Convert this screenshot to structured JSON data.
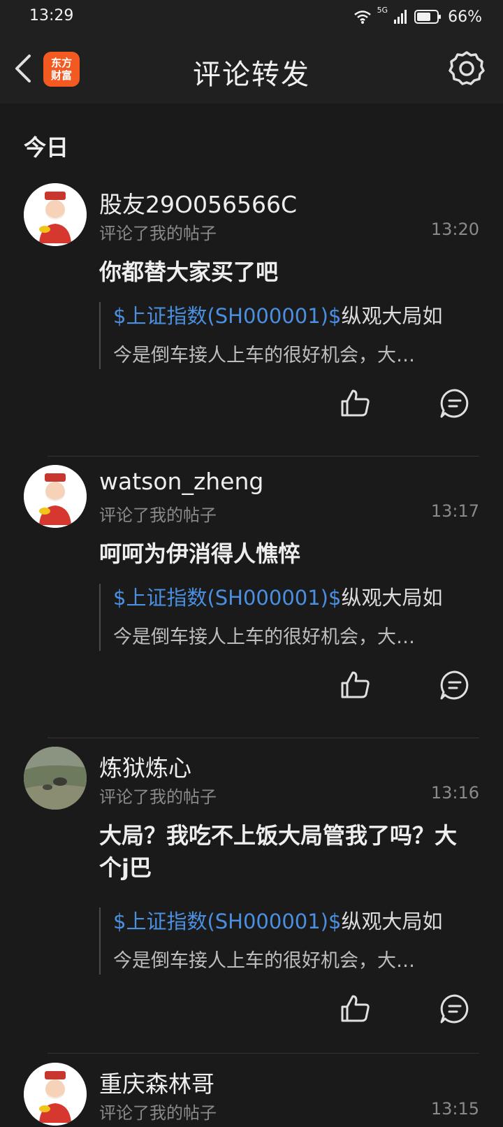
{
  "status_bar": {
    "time": "13:29",
    "network": "5G",
    "battery": "66%"
  },
  "header": {
    "logo_line1": "东方",
    "logo_line2": "财富",
    "title": "评论转发",
    "icons": {
      "back": "chevron-left-icon",
      "settings": "gear-icon"
    }
  },
  "section": {
    "title": "今日"
  },
  "colors": {
    "background": "#1a1a1a",
    "header_background": "#202020",
    "link": "#4a8fe0",
    "logo": "#f25a22"
  },
  "items": [
    {
      "username": "股友29O056566C",
      "subtitle": "评论了我的帖子",
      "time": "13:20",
      "comment": "你都替大家买了吧",
      "quote_link": "$上证指数(SH000001)$",
      "quote_text": "纵观大局如",
      "quote_line2": "今是倒车接人上车的很好机会，大…",
      "avatar": "cartoon-god-of-wealth"
    },
    {
      "username": "watson_zheng",
      "subtitle": "评论了我的帖子",
      "time": "13:17",
      "comment": "呵呵为伊消得人憔悴",
      "quote_link": "$上证指数(SH000001)$",
      "quote_text": "纵观大局如",
      "quote_line2": "今是倒车接人上车的很好机会，大…",
      "avatar": "cartoon-god-of-wealth"
    },
    {
      "username": "炼狱炼心",
      "subtitle": "评论了我的帖子",
      "time": "13:16",
      "comment": "大局？我吃不上饭大局管我了吗？大个j巴",
      "quote_link": "$上证指数(SH000001)$",
      "quote_text": "纵观大局如",
      "quote_line2": "今是倒车接人上车的很好机会，大…",
      "avatar": "landscape-photo"
    },
    {
      "username": "重庆森林哥",
      "subtitle": "评论了我的帖子",
      "time": "13:15",
      "avatar": "cartoon-god-of-wealth"
    }
  ]
}
